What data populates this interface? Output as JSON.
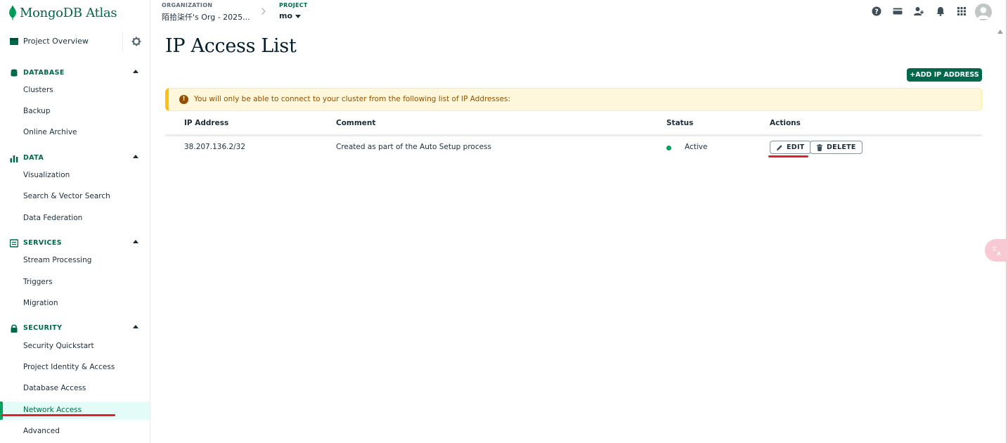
{
  "app": {
    "logo_text": "MongoDB Atlas"
  },
  "header": {
    "org_label": "ORGANIZATION",
    "org_value": "陌拾柒仟's Org - 2025...",
    "project_label": "PROJECT",
    "project_value": "mo",
    "icons": [
      "help-icon",
      "billing-icon",
      "invite-user-icon",
      "notifications-icon",
      "apps-grid-icon"
    ]
  },
  "sidebar": {
    "project_overview": "Project Overview",
    "sections": [
      {
        "title": "DATABASE",
        "icon": "database-icon",
        "items": [
          "Clusters",
          "Backup",
          "Online Archive"
        ]
      },
      {
        "title": "DATA",
        "icon": "bar-chart-icon",
        "items": [
          "Visualization",
          "Search & Vector Search",
          "Data Federation"
        ]
      },
      {
        "title": "SERVICES",
        "icon": "services-icon",
        "items": [
          "Stream Processing",
          "Triggers",
          "Migration"
        ]
      },
      {
        "title": "SECURITY",
        "icon": "lock-icon",
        "items": [
          "Security Quickstart",
          "Project Identity & Access",
          "Database Access",
          "Network Access",
          "Advanced"
        ]
      }
    ],
    "active_item": "Network Access"
  },
  "main": {
    "title": "IP Access List",
    "add_button": "+ADD IP ADDRESS",
    "banner_text": "You will only be able to connect to your cluster from the following list of IP Addresses:",
    "table": {
      "headers": [
        "IP Address",
        "Comment",
        "Status",
        "Actions"
      ],
      "rows": [
        {
          "ip": "38.207.136.2/32",
          "comment": "Created as part of the Auto Setup process",
          "status": "Active",
          "edit": "EDIT",
          "delete": "DELETE"
        }
      ]
    }
  },
  "colors": {
    "brand_green": "#00684a",
    "accent_green": "#00a35c",
    "warning_bg": "#fef7db",
    "warning_text": "#944f01",
    "annotation_red": "#e0202a"
  }
}
